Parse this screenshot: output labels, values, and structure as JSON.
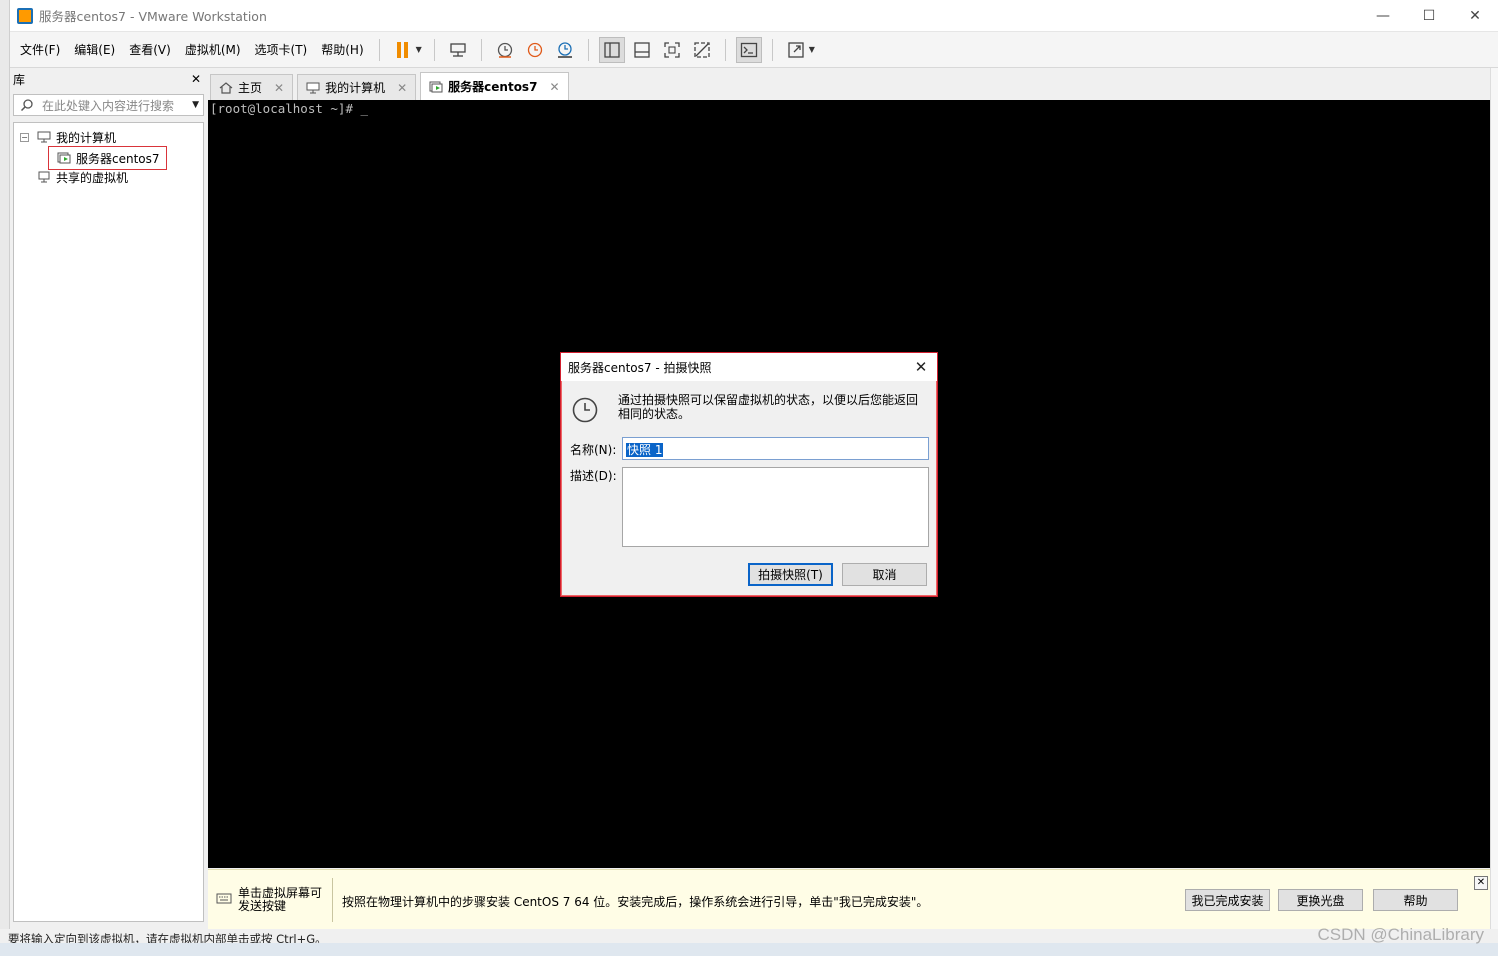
{
  "window": {
    "title": "服务器centos7 - VMware Workstation",
    "controls": {
      "minimize": "—",
      "maximize": "☐",
      "close": "✕"
    }
  },
  "menubar": {
    "items": [
      "文件(F)",
      "编辑(E)",
      "查看(V)",
      "虚拟机(M)",
      "选项卡(T)",
      "帮助(H)"
    ]
  },
  "library": {
    "title": "库",
    "close": "✕",
    "search_placeholder": "在此处键入内容进行搜索",
    "tree": {
      "toggle": "−",
      "root": "我的计算机",
      "vm": "服务器centos7",
      "shared": "共享的虚拟机"
    }
  },
  "tabs": [
    {
      "label": "主页",
      "close": "✕"
    },
    {
      "label": "我的计算机",
      "close": "✕"
    },
    {
      "label": "服务器centos7",
      "close": "✕"
    }
  ],
  "console": {
    "prompt": "[root@localhost ~]# _"
  },
  "dialog": {
    "title": "服务器centos7 - 拍摄快照",
    "close": "✕",
    "message": "通过拍摄快照可以保留虚拟机的状态，以便以后您能返回相同的状态。",
    "name_label": "名称(N):",
    "name_value": "快照 1",
    "description_label": "描述(D):",
    "description_value": "",
    "take_button": "拍摄快照(T)",
    "cancel_button": "取消"
  },
  "infobar": {
    "hint": "单击虚拟屏幕可发送按键",
    "message": "按照在物理计算机中的步骤安装 CentOS 7 64 位。安装完成后，操作系统会进行引导，单击\"我已完成安装\"。",
    "buttons": [
      "我已完成安装",
      "更换光盘",
      "帮助"
    ],
    "close": "✕"
  },
  "status": {
    "text": "要将输入定向到该虚拟机，请在虚拟机内部单击或按 Ctrl+G。"
  },
  "watermark": "CSDN @ChinaLibrary",
  "colors": {
    "accent_orange": "#ff9a00",
    "selection_blue": "#0a64c8",
    "highlight_red": "#d11f2f",
    "infobar_bg": "#fffde6",
    "console_bg": "#000000"
  }
}
